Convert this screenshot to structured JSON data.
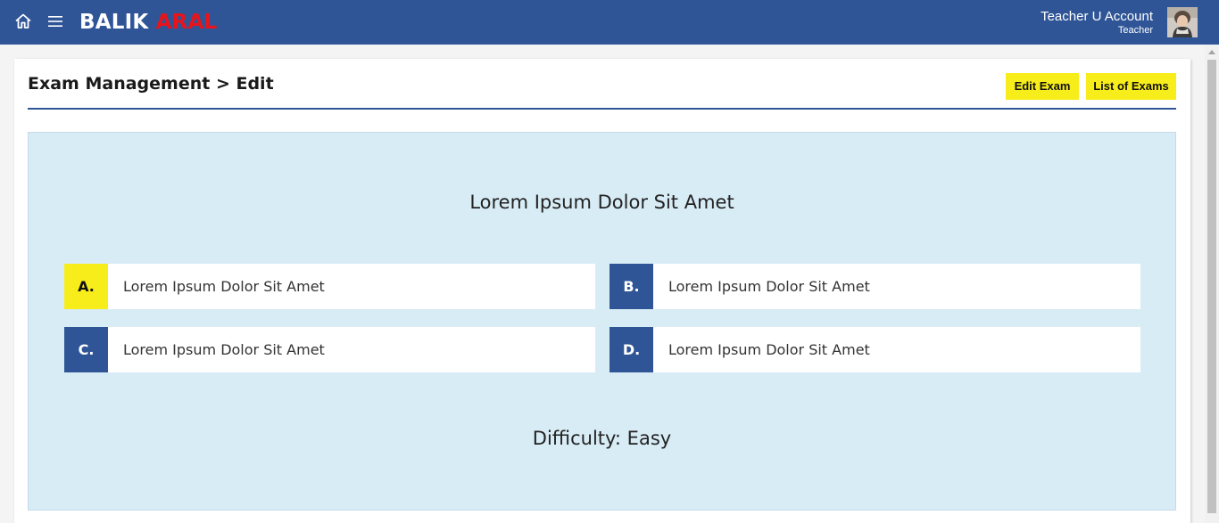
{
  "brand": {
    "part1": "BALIK",
    "part2": "ARAL"
  },
  "account": {
    "name": "Teacher U Account",
    "role": "Teacher"
  },
  "page": {
    "title": "Exam Management > Edit"
  },
  "actions": {
    "edit_exam": "Edit Exam",
    "list_exams": "List of Exams"
  },
  "question": {
    "text": "Lorem Ipsum Dolor Sit Amet",
    "options": [
      {
        "letter": "A.",
        "text": "Lorem Ipsum Dolor Sit Amet",
        "highlight": "yellow"
      },
      {
        "letter": "B.",
        "text": "Lorem Ipsum Dolor Sit Amet",
        "highlight": "blue"
      },
      {
        "letter": "C.",
        "text": "Lorem Ipsum Dolor Sit Amet",
        "highlight": "blue"
      },
      {
        "letter": "D.",
        "text": "Lorem Ipsum Dolor Sit Amet",
        "highlight": "blue"
      }
    ],
    "difficulty": "Difficulty: Easy"
  },
  "icons": {
    "home": "home-icon",
    "menu": "hamburger-menu-icon"
  },
  "colors": {
    "primary": "#2f5597",
    "accent": "#f7ed1b",
    "brand_red": "#e8141b",
    "panel": "#d8ecf6"
  }
}
